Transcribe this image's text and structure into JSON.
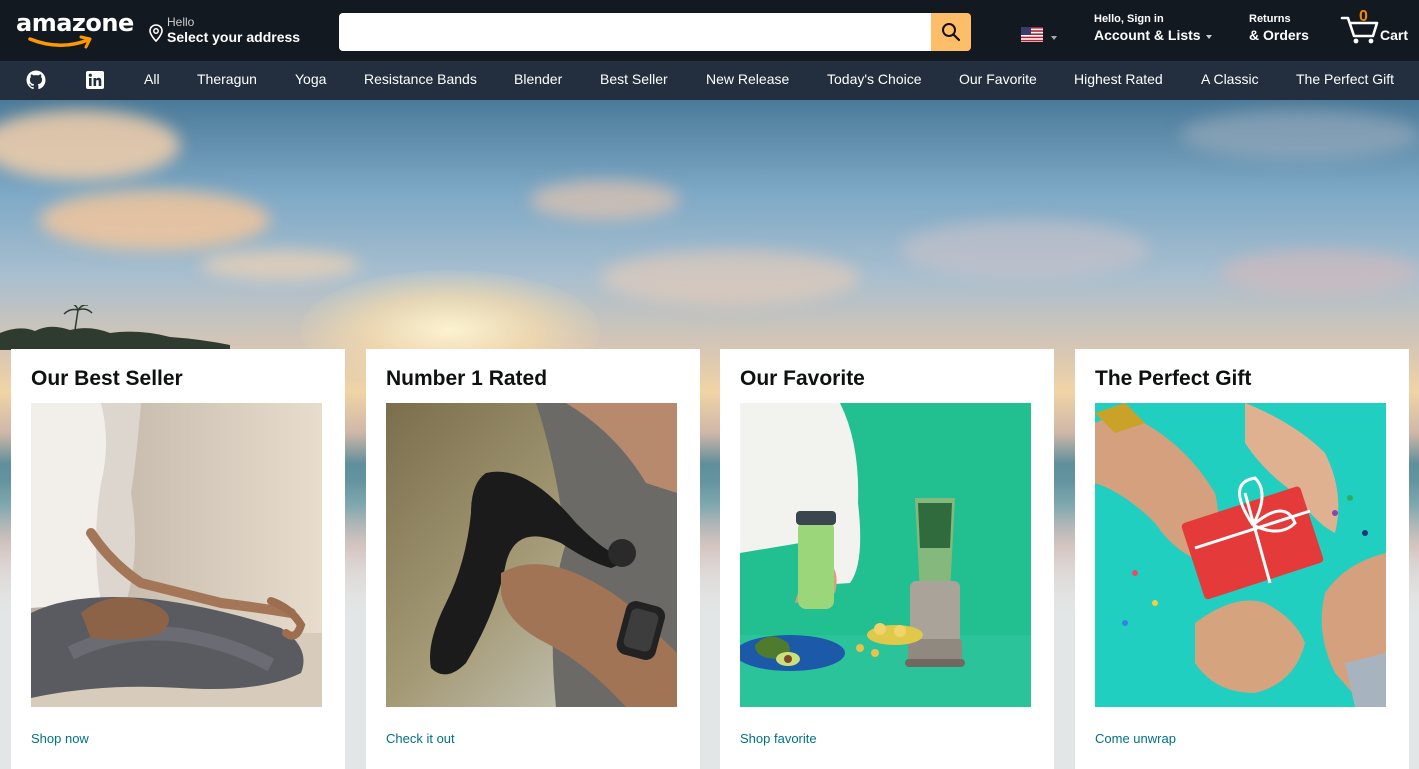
{
  "header": {
    "logo_text": "amazone",
    "address_greeting": "Hello",
    "address_action": "Select your address",
    "search_placeholder": "",
    "account_greeting": "Hello, Sign in",
    "account_label": "Account & Lists",
    "returns_label": "Returns",
    "orders_label": "& Orders",
    "cart_count": "0",
    "cart_label": "Cart"
  },
  "nav": {
    "icons": [
      "github-icon",
      "linkedin-icon"
    ],
    "items": [
      "All",
      "Theragun",
      "Yoga",
      "Resistance Bands",
      "Blender",
      "Best Seller",
      "New Release",
      "Today's Choice",
      "Our Favorite",
      "Highest Rated",
      "A Classic",
      "The Perfect Gift"
    ]
  },
  "cards": [
    {
      "title": "Our Best Seller",
      "link": "Shop now",
      "image": "yoga-meditation"
    },
    {
      "title": "Number 1 Rated",
      "link": "Check it out",
      "image": "theragun-massager"
    },
    {
      "title": "Our Favorite",
      "link": "Shop favorite",
      "image": "nutribullet-blender"
    },
    {
      "title": "The Perfect Gift",
      "link": "Come unwrap",
      "image": "gift-box-hands"
    }
  ],
  "colors": {
    "header_bg": "#131921",
    "nav_bg": "#232f3e",
    "search_button": "#febd69",
    "cart_count": "#f08804",
    "link": "#007185"
  }
}
